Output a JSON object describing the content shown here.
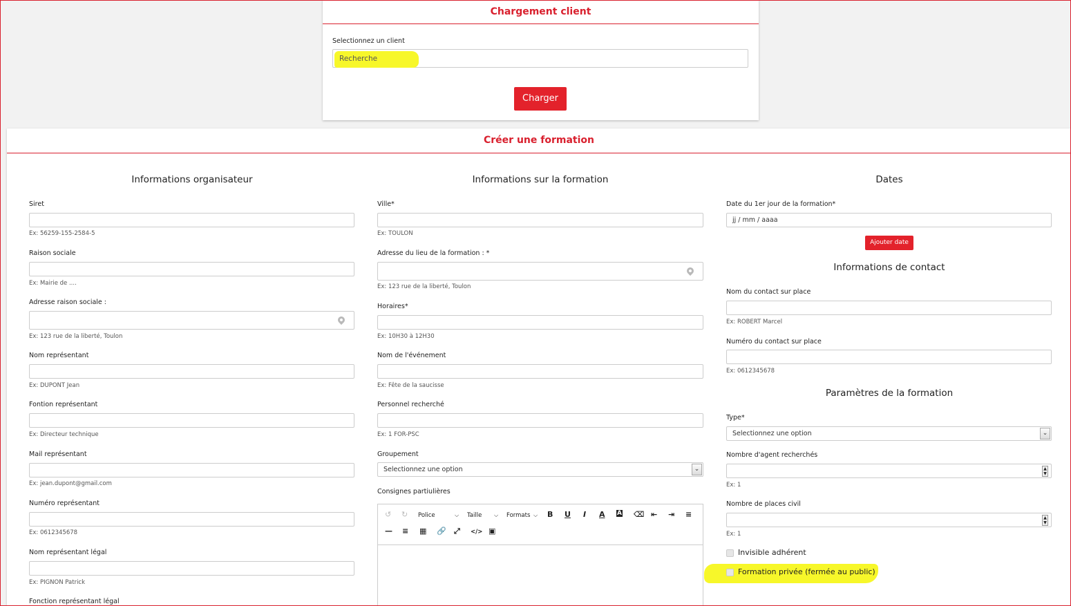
{
  "load": {
    "title": "Chargement client",
    "label": "Selectionnez un client",
    "search_placeholder": "Recherche",
    "button": "Charger"
  },
  "form": {
    "title": "Créer une formation",
    "organizer": {
      "title": "Informations organisateur",
      "fields": [
        {
          "label": "Siret",
          "hint": "Ex: 56259-155-2584-5"
        },
        {
          "label": "Raison sociale",
          "hint": "Ex: Mairie de ...."
        },
        {
          "label": "Adresse raison sociale :",
          "hint": "Ex: 123 rue de la liberté, Toulon"
        },
        {
          "label": "Nom représentant",
          "hint": "Ex: DUPONT Jean"
        },
        {
          "label": "Fontion représentant",
          "hint": "Ex: Directeur technique"
        },
        {
          "label": "Mail représentant",
          "hint": "Ex: jean.dupont@gmail.com"
        },
        {
          "label": "Numéro représentant",
          "hint": "Ex: 0612345678"
        },
        {
          "label": "Nom représentant légal",
          "hint": "Ex: PIGNON Patrick"
        },
        {
          "label": "Fonction représentant légal",
          "hint": ""
        }
      ]
    },
    "training": {
      "title": "Informations sur la formation",
      "fields": [
        {
          "label": "Ville*",
          "hint": "Ex: TOULON"
        },
        {
          "label": "Adresse du lieu de la formation : *",
          "hint": "Ex: 123 rue de la liberté, Toulon"
        },
        {
          "label": "Horaires*",
          "hint": "Ex: 10H30 à 12H30"
        },
        {
          "label": "Nom de l'événement",
          "hint": "Ex: Fête de la saucisse"
        },
        {
          "label": "Personnel recherché",
          "hint": "Ex: 1 FOR-PSC"
        }
      ],
      "groupement_label": "Groupement",
      "groupement_value": "Selectionnez une option",
      "consignes_label": "Consignes partiulières",
      "editor": {
        "police": "Police",
        "taille": "Taille",
        "formats": "Formats"
      }
    },
    "dates": {
      "title": "Dates",
      "first_day_label": "Date du 1er jour de la formation*",
      "first_day_placeholder": "jj / mm / aaaa",
      "add_button": "Ajouter date"
    },
    "contact": {
      "title": "Informations de contact",
      "name_label": "Nom du contact sur place",
      "name_hint": "Ex: ROBERT Marcel",
      "phone_label": "Numéro du contact sur place",
      "phone_hint": "Ex: 0612345678"
    },
    "params": {
      "title": "Paramètres de la formation",
      "type_label": "Type*",
      "type_value": "Selectionnez une option",
      "agents_label": "Nombre d'agent recherchés",
      "agents_hint": "Ex: 1",
      "civil_label": "Nombre de places civil",
      "civil_hint": "Ex: 1",
      "invisible_label": "Invisible adhérent",
      "private_label": "Formation privée (fermée au public)"
    }
  },
  "colors": {
    "accent": "#d9202e",
    "button": "#e3222b",
    "highlight": "#f7f72a"
  }
}
